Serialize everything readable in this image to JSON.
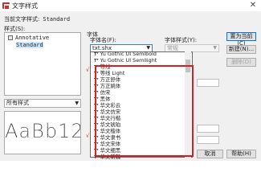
{
  "window": {
    "title": "文字样式",
    "close_glyph": "✕"
  },
  "current_style": {
    "label": "当前文字样式:",
    "value": "Standard"
  },
  "styles_section": {
    "label": "样式(S):",
    "items": [
      "Annotative",
      "Standard"
    ],
    "selected_index": 1
  },
  "filter": {
    "value": "所有样式"
  },
  "preview": {
    "sample_text": "AaBb12"
  },
  "font_group": {
    "group_label": "字体",
    "font_name_label": "字体名(F):",
    "font_style_label": "字体样式(Y):",
    "font_name_value": "txt.shx",
    "font_style_value": "常规"
  },
  "font_dropdown": {
    "items": [
      "Yu Gothic UI Semibold",
      "Yu Gothic UI Semilight",
      "等线",
      "等线 Light",
      "方正舒体",
      "方正姚体",
      "仿宋",
      "黑体",
      "华文彩云",
      "华文仿宋",
      "华文行楷",
      "华文琥珀",
      "华文楷体",
      "华文隶书",
      "华文宋体",
      "华文细黑",
      "华文新魏",
      "华文中宋"
    ]
  },
  "buttons": {
    "set_current": "置为当前(C)",
    "new": "新建(N)...",
    "delete": "删除(D)",
    "cancel": "取消",
    "help": "帮助(H)"
  },
  "colors": {
    "highlight": "#d81f1f",
    "selection": "#cde8ff",
    "dialog_bg": "#f0f0f0"
  }
}
